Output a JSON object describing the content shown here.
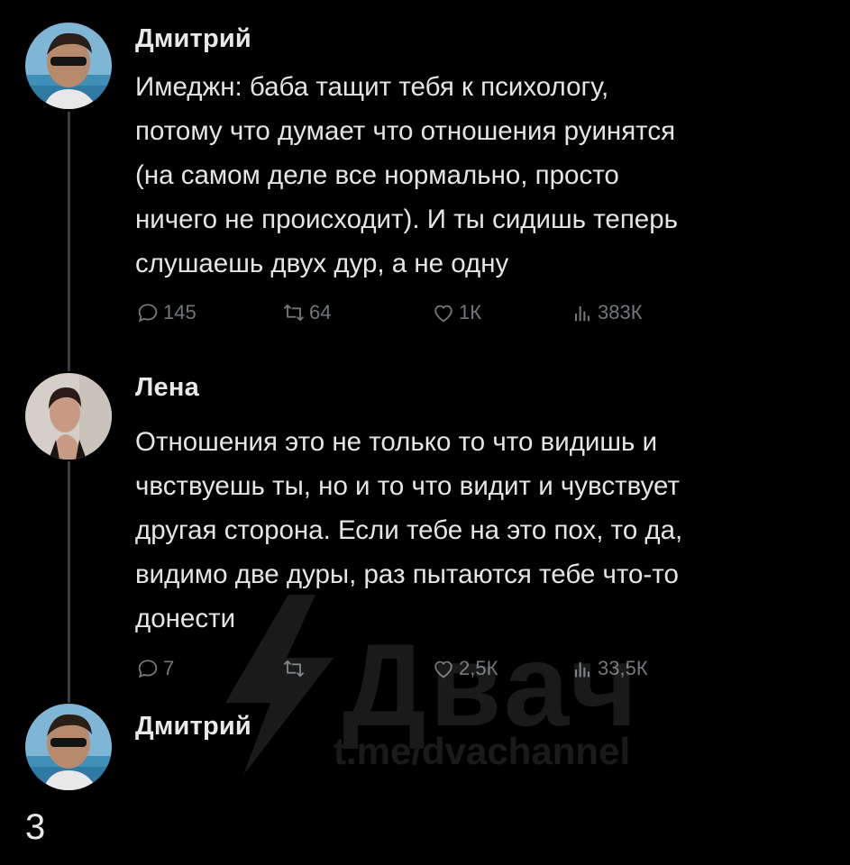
{
  "tweets": [
    {
      "author": "Дмитрий",
      "text": "Имеджн: баба тащит тебя к психологу,\nпотому что думает что отношения руинятся\n(на самом деле все нормально, просто\nничего не происходит). И ты сидишь теперь\nслушаешь двух дур, а не одну",
      "replies": "145",
      "retweets": "64",
      "likes": "1К",
      "views": "383К"
    },
    {
      "author": "Лена",
      "text": "Отношения это не только то что видишь и\nчвствуешь ты, но и то что видит и чувствует\nдругая сторона. Если тебе на это пох, то да,\nвидимо две дуры, раз пытаются тебе что-то\nдонести",
      "replies": "7",
      "retweets": "",
      "likes": "2,5К",
      "views": "33,5К"
    },
    {
      "author": "Дмитрий"
    }
  ],
  "watermark": {
    "logo": "Двач",
    "url": "t.me/dvachannel"
  },
  "page_number": "3",
  "colors": {
    "background": "#000000",
    "text": "#e7e9ea",
    "muted": "#71767b",
    "thread_line": "#3a3d40"
  }
}
